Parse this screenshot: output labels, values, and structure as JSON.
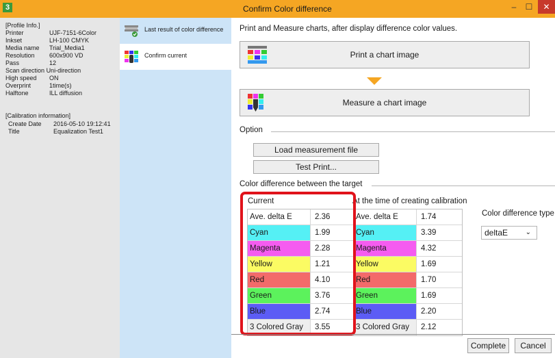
{
  "window": {
    "logo": "3",
    "title": "Confirm Color difference",
    "minimize": "–",
    "maximize": "☐",
    "close": "✕"
  },
  "profile": {
    "heading": "[Profile Info.]",
    "rows": [
      {
        "k": "Printer",
        "v": "UJF-7151-6Color"
      },
      {
        "k": "Inkset",
        "v": "LH-100 CMYK"
      },
      {
        "k": "Media name",
        "v": "Trial_Media1"
      },
      {
        "k": "Resolution",
        "v": "600x900 VD"
      },
      {
        "k": "Pass",
        "v": "12"
      },
      {
        "k": "Scan direction",
        "v": "Uni-direction"
      },
      {
        "k": "High speed",
        "v": "ON"
      },
      {
        "k": "Overprint",
        "v": "1time(s)"
      },
      {
        "k": "Halftone",
        "v": "ILL diffusion"
      }
    ]
  },
  "calibration": {
    "heading": "[Calibration information]",
    "rows": [
      {
        "k": "Create Date",
        "v": "2016-05-10 19:12:41"
      },
      {
        "k": "Title",
        "v": "Equalization Test1"
      }
    ]
  },
  "nav": [
    {
      "label": "Last result of color difference",
      "icon": "printer-check-icon"
    },
    {
      "label": "Confirm current",
      "icon": "color-chart-icon"
    }
  ],
  "main": {
    "instruction": "Print and Measure charts, after display difference color values.",
    "print_button": "Print a chart image",
    "measure_button": "Measure a chart image",
    "option_label": "Option",
    "load_button": "Load measurement file",
    "test_print_button": "Test Print...",
    "diff_label": "Color difference between the target",
    "current_label": "Current",
    "calibration_label": "At the time of creating calibration",
    "type_label": "Color difference type",
    "type_value": "deltaE",
    "complete_button": "Complete",
    "cancel_button": "Cancel"
  },
  "colors": {
    "title_bar": "#f5a623",
    "highlight": "#e0131b",
    "Cyan": "#55f0f5",
    "Magenta": "#f55cf0",
    "Yellow": "#fbfb63",
    "Red": "#f36a6a",
    "Green": "#5cf25c",
    "Blue": "#5c5cf5",
    "3 Colored Gray": "#eeeeee",
    "Ave. delta E": "#ffffff"
  },
  "current_table": [
    {
      "name": "Ave. delta E",
      "value": "2.36"
    },
    {
      "name": "Cyan",
      "value": "1.99"
    },
    {
      "name": "Magenta",
      "value": "2.28"
    },
    {
      "name": "Yellow",
      "value": "1.21"
    },
    {
      "name": "Red",
      "value": "4.10"
    },
    {
      "name": "Green",
      "value": "3.76"
    },
    {
      "name": "Blue",
      "value": "2.74"
    },
    {
      "name": "3 Colored Gray",
      "value": "3.55"
    }
  ],
  "calibration_table": [
    {
      "name": "Ave. delta E",
      "value": "1.74"
    },
    {
      "name": "Cyan",
      "value": "3.39"
    },
    {
      "name": "Magenta",
      "value": "4.32"
    },
    {
      "name": "Yellow",
      "value": "1.69"
    },
    {
      "name": "Red",
      "value": "1.70"
    },
    {
      "name": "Green",
      "value": "1.69"
    },
    {
      "name": "Blue",
      "value": "2.20"
    },
    {
      "name": "3 Colored Gray",
      "value": "2.12"
    }
  ]
}
